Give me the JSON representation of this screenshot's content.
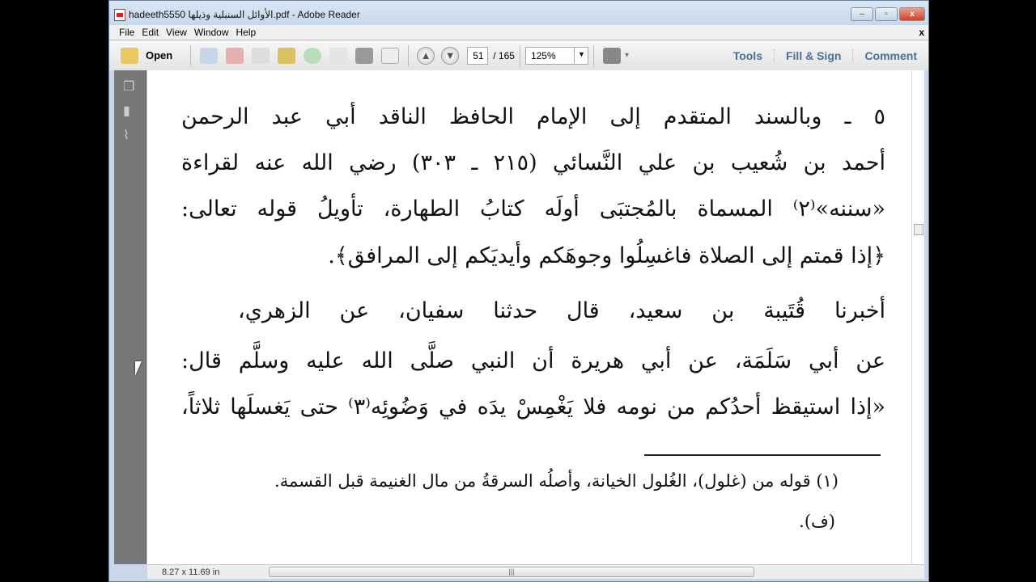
{
  "window": {
    "title": "hadeeth5550 الأوائل السنبلية وذيلها.pdf - Adobe Reader",
    "min": "–",
    "max": "▫",
    "close": "x"
  },
  "menu": [
    "File",
    "Edit",
    "View",
    "Window",
    "Help"
  ],
  "menu_close": "x",
  "toolbar": {
    "open": "Open",
    "page": "51",
    "total": "/ 165",
    "zoom": "125%",
    "tools": "Tools",
    "fill_sign": "Fill & Sign",
    "comment": "Comment"
  },
  "document": {
    "lines": [
      "٥ ـ وبالسند المتقدم إلى الإمام الحافظ الناقد أبي عبد الرحمن",
      "أحمد بن شُعيب بن علي النَّسائي (٢١٥ ـ ٣٠٣) رضي الله عنه لقراءة",
      "«سننه»⁽٢⁾ المسماة بالمُجتبَى أولَه كتابُ الطهارة، تأويلُ قوله تعالى:",
      "﴿إذا قمتم إلى الصلاة فاغسِلُوا وجوهَكم وأيديَكم إلى المرافق﴾.",
      "أخبرنا قُتَيبة بن سعيد، قال حدثنا سفيان، عن الزهري،",
      "عن أبي سَلَمَة، عن أبي هريرة أن النبي صلَّى الله عليه وسلَّم قال:",
      "«إذا استيقظ أحدُكم من نومه فلا يَغْمِسْ يدَه في وَضُوئِه⁽٣⁾ حتى يَغسلَها ثلاثاً،"
    ],
    "footnotes": [
      "(١) قوله من (غلول)، الغُلول الخيانة، وأصلُه السرقةُ من مال الغنيمة قبل القسمة.",
      "(ف)."
    ]
  },
  "status": {
    "size": "8.27 x 11.69 in"
  }
}
